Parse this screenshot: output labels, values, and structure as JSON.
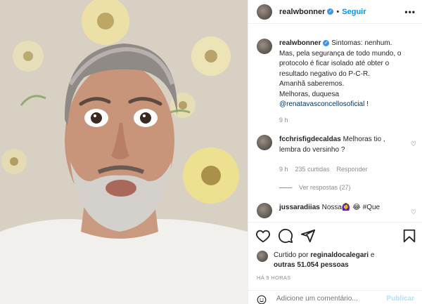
{
  "post": {
    "username": "realwbonner",
    "follow_label": "Seguir",
    "more_label": "•••",
    "caption_lines": [
      "Sintomas: nenhum.",
      "Mas, pela segurança de todo mundo, o",
      "protocolo é ficar isolado até obter o",
      "resultado negativo do P-C-R.",
      "Amanhã saberemos.",
      "Melhoras, duquesa"
    ],
    "caption_mention": "@renatavasconcellosoficial",
    "caption_end": " !",
    "caption_time": "9 h"
  },
  "comments": [
    {
      "username": "fcchrisfigdecaldas",
      "text": " Melhoras tio ,",
      "text2": "lembra do versinho ?",
      "time": "9 h",
      "likes": "235 curtidas",
      "reply": "Responder",
      "view_replies": "Ver respostas (27)"
    },
    {
      "username": "jussaradiias",
      "text": " Nossa🙆‍♀️ 😂 #Que"
    }
  ],
  "likes": {
    "prefix": "Curtido por ",
    "user": "reginaldocalegari",
    "mid": " e",
    "others": "outras 51.054 pessoas"
  },
  "timestamp": "HÁ 9 HORAS",
  "add_comment": {
    "placeholder": "Adicione um comentário...",
    "publish": "Publicar"
  },
  "colors": {
    "link": "#0095f6",
    "mention": "#00376b",
    "muted": "#8e8e8e"
  },
  "icons": [
    "heart-icon",
    "comment-icon",
    "share-icon",
    "bookmark-icon",
    "emoji-icon"
  ]
}
